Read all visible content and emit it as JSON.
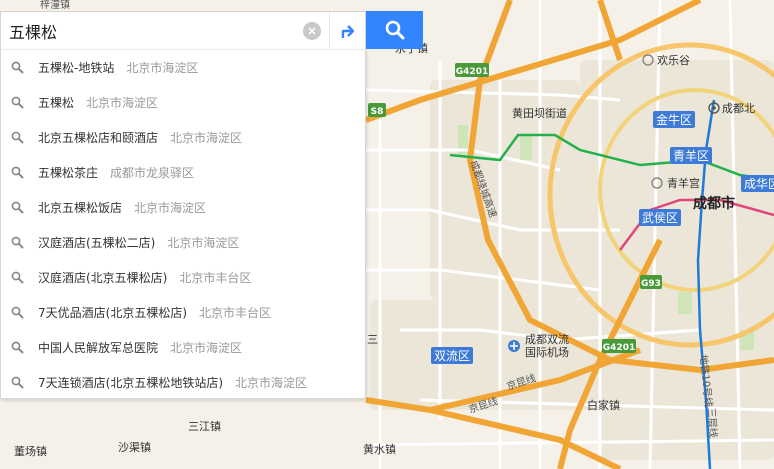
{
  "search": {
    "query": "五棵松",
    "placeholder": ""
  },
  "icons": {
    "clear": "clear-icon",
    "route": "route-icon",
    "search": "search-icon",
    "suggestion": "search-icon"
  },
  "colors": {
    "search_button": "#3385ff",
    "district_badge": "#3d7bd6",
    "highway_shield": "#4a9a3c",
    "metro_green": "#22b14c",
    "metro_blue": "#1f7ad8",
    "metro_red": "#e0457b",
    "ring_road": "#f4b94a"
  },
  "suggestions": [
    {
      "name": "五棵松-地铁站",
      "area": "北京市海淀区"
    },
    {
      "name": "五棵松",
      "area": "北京市海淀区"
    },
    {
      "name": "北京五棵松店和颐酒店",
      "area": "北京市海淀区"
    },
    {
      "name": "五棵松茶庄",
      "area": "成都市龙泉驿区"
    },
    {
      "name": "北京五棵松饭店",
      "area": "北京市海淀区"
    },
    {
      "name": "汉庭酒店(五棵松二店)",
      "area": "北京市海淀区"
    },
    {
      "name": "汉庭酒店(北京五棵松店)",
      "area": "北京市丰台区"
    },
    {
      "name": "7天优品酒店(北京五棵松店)",
      "area": "北京市丰台区"
    },
    {
      "name": "中国人民解放军总医院",
      "area": "北京市海淀区"
    },
    {
      "name": "7天连锁酒店(北京五棵松地铁站店)",
      "area": "北京市海淀区"
    }
  ],
  "map": {
    "places": {
      "xianglin": "梓潼镇",
      "yongning": "永宁镇",
      "huanletu": "欢乐谷",
      "chengdubei": "成都北",
      "huangtianba": "黄田坝街道",
      "qingyanggong": "青羊宫",
      "chengdu": "成都市",
      "airport_a": "成都双流",
      "airport_b": "国际机场",
      "baijia": "白家镇",
      "sanjiang": "三江镇",
      "shaqu": "沙渠镇",
      "huangshui": "黄水镇",
      "chaoyang": "董场镇",
      "sanshu": "三"
    },
    "roads": {
      "rao_cheng_gao_su": "成都绕城高速",
      "jingkun": "京昆线",
      "jingkun2": "京昆线",
      "metro10": "地铁10号线",
      "lineup": "三层线"
    },
    "districts": {
      "jinniu": "金牛区",
      "qingyang": "青羊区",
      "wuhou": "武侯区",
      "chenghua": "成华区",
      "shuangliu": "双流区"
    },
    "shields": {
      "g4201_top": "G4201",
      "s8": "S8",
      "g93": "G93",
      "g4201_bottom": "G4201"
    }
  }
}
